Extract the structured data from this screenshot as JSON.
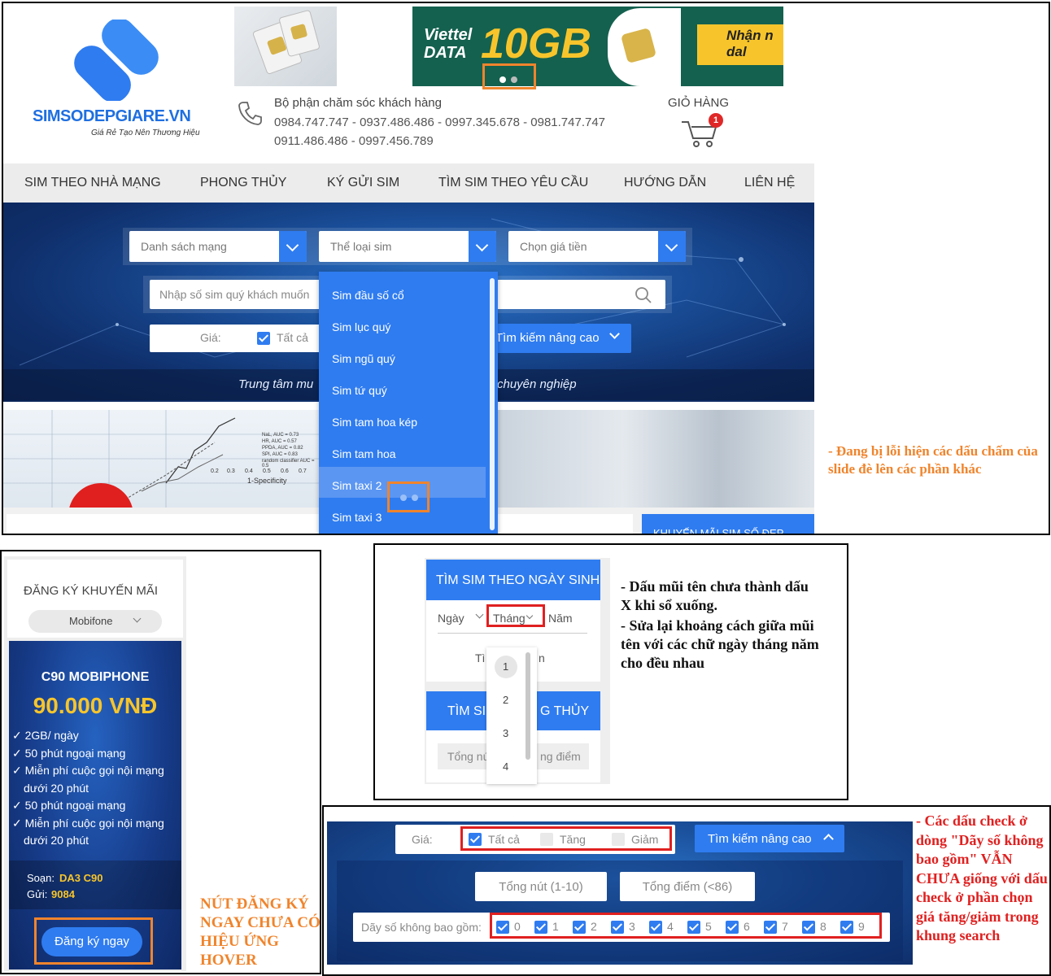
{
  "header": {
    "logo_text": "SIMSODEPGIARE.VN",
    "logo_tagline": "Giá Rẻ Tạo Nên Thương Hiệu",
    "banner_text_brand": "Viettel DATA",
    "banner_text_big": "10GB",
    "banner_text_tail": "Nhận n dal",
    "support_title": "Bộ phận chăm sóc khách hàng",
    "support_phones_1": "0984.747.747 - 0937.486.486 - 0997.345.678 - 0981.747.747",
    "support_phones_2": "0911.486.486 - 0997.456.789",
    "cart_label": "GIỎ HÀNG",
    "cart_count": "1"
  },
  "nav": {
    "items": [
      "SIM THEO NHÀ MẠNG",
      "PHONG THỦY",
      "KÝ GỬI SIM",
      "TÌM SIM THEO YÊU CẦU",
      "HƯỚNG DẪN",
      "LIÊN HỆ"
    ]
  },
  "search": {
    "network_placeholder": "Danh sách mạng",
    "type_placeholder": "Thể loại sim",
    "price_placeholder": "Chọn giá tiền",
    "input_placeholder": "Nhập số sim quý khách muốn",
    "price_label": "Giá:",
    "all_label": "Tất cả",
    "advanced_label": "Tìm kiếm nâng cao",
    "tagline_left": "Trung tâm mu",
    "tagline_right": "chuyên nghiệp"
  },
  "dropdown": {
    "items": [
      "Sim đầu số cổ",
      "Sim lục quý",
      "Sim ngũ quý",
      "Sim tứ quý",
      "Sim tam hoa kép",
      "Sim tam hoa",
      "Sim taxi 2",
      "Sim taxi 3"
    ]
  },
  "promo_strip_label": "KHUYẾN MÃI SIM SỐ ĐẸP",
  "chart_snippet": {
    "x_label": "1-Specificity",
    "legend": [
      "NaL, AUC = 0.73",
      "HR, AUC = 0.57",
      "PPDA, AUC = 0.82",
      "SPI, AUC = 0.83",
      "random classifier AUC = 0.5"
    ],
    "ticks": [
      "0.2",
      "0.3",
      "0.4",
      "0.5",
      "0.6",
      "0.7"
    ]
  },
  "notes": {
    "dots_bug": "- Đang bị lỗi hiện các dấu chấm của slide đè lên các phần khác",
    "arrow_bug_1": "- Dấu mũi tên chưa thành dấu X khi sổ xuống.",
    "arrow_bug_2": "- Sửa lại khoảng cách giữa mũi tên với các chữ ngày tháng năm cho đều nhau",
    "hover_bug": "NÚT ĐĂNG KÝ NGAY CHƯA CÓ HIỆU ỨNG HOVER",
    "check_bug": "- Các dấu check ở dòng \"Dãy số không bao gồm\" VẪN CHƯA giống với dấu check ở phần chọn giá tăng/giảm trong khung search"
  },
  "promo": {
    "title": "ĐĂNG KÝ KHUYẾN MÃI",
    "network": "Mobifone",
    "plan_name": "C90 MOBIPHONE",
    "price": "90.000 VNĐ",
    "features": [
      "2GB/ ngày",
      "50 phút ngoại mạng",
      "Miễn phí cuộc gọi nội mạng",
      "dưới 20 phút",
      "50 phút ngoại mạng",
      "Miễn phí cuộc gọi nội mạng",
      "dưới 20 phút"
    ],
    "compose_label": "Soạn:",
    "compose_value": "DA3 C90",
    "send_label": "Gửi:",
    "send_value": "9084",
    "register_button": "Đăng ký ngay"
  },
  "birthday": {
    "title": "TÌM SIM THEO NGÀY SINH",
    "day": "Ngày",
    "month": "Tháng",
    "year": "Năm",
    "search_partial_left": "Tì",
    "search_partial_right": "n",
    "month_options": [
      "1",
      "2",
      "3",
      "4"
    ],
    "feng_left": "TÌM SI",
    "feng_right": "G THỦY",
    "total_left": "Tổng nú",
    "total_right": "ng điểm"
  },
  "advanced": {
    "price_label": "Giá:",
    "all": "Tất cả",
    "inc": "Tăng",
    "dec": "Giảm",
    "advanced_label": "Tìm kiếm nâng cao",
    "sum_buttons": "Tổng nút (1-10)",
    "sum_points": "Tổng điểm (<86)",
    "exclude_label": "Dãy số không bao gồm:",
    "digits": [
      "0",
      "1",
      "2",
      "3",
      "4",
      "5",
      "6",
      "7",
      "8",
      "9"
    ]
  }
}
